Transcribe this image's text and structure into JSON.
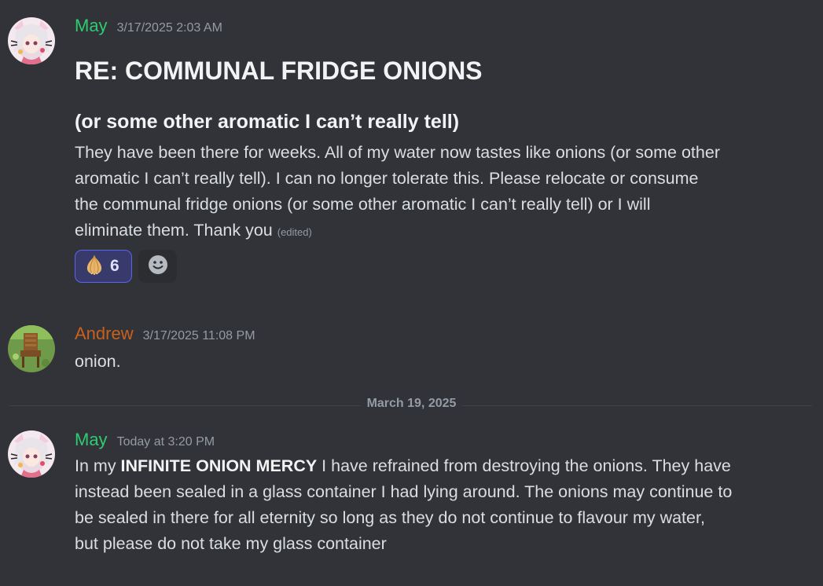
{
  "colors": {
    "background": "#313338",
    "may_name": "#2ecc71",
    "andrew_name": "#c7621c",
    "timestamp": "#949ba4",
    "reaction_active_border": "#5865f2"
  },
  "messages": [
    {
      "author": "May",
      "timestamp": "3/17/2025 2:03 AM",
      "heading1": "RE: COMMUNAL FRIDGE ONIONS",
      "heading2": "(or some other aromatic I can’t really tell)",
      "body_lines": [
        "They have been there for weeks. All of my water now tastes like onions (or some other",
        "aromatic I can’t really tell). I can no longer tolerate this. Please relocate or consume",
        "the communal fridge onions (or some other aromatic I can’t really tell) or I will",
        "eliminate them. Thank you"
      ],
      "edited": "(edited)",
      "reactions": [
        {
          "icon": "onion-emoji-icon",
          "count": "6"
        }
      ],
      "add_reaction_icon": "smiley-add-reaction-icon"
    },
    {
      "author": "Andrew",
      "timestamp": "3/17/2025 11:08 PM",
      "body": "onion."
    },
    {
      "author": "May",
      "timestamp": "Today at 3:20 PM",
      "body_prefix": "In my ",
      "body_bold": "INFINITE ONION MERCY",
      "body_line1_rest": " I have refrained from destroying the onions. They have",
      "body_lines": [
        "instead been sealed in a glass container I had lying around. The onions may continue to",
        "be sealed in there for all eternity so long as they do not continue to flavour my water,",
        "but please do not take my glass container"
      ]
    }
  ],
  "date_divider": "March 19, 2025"
}
